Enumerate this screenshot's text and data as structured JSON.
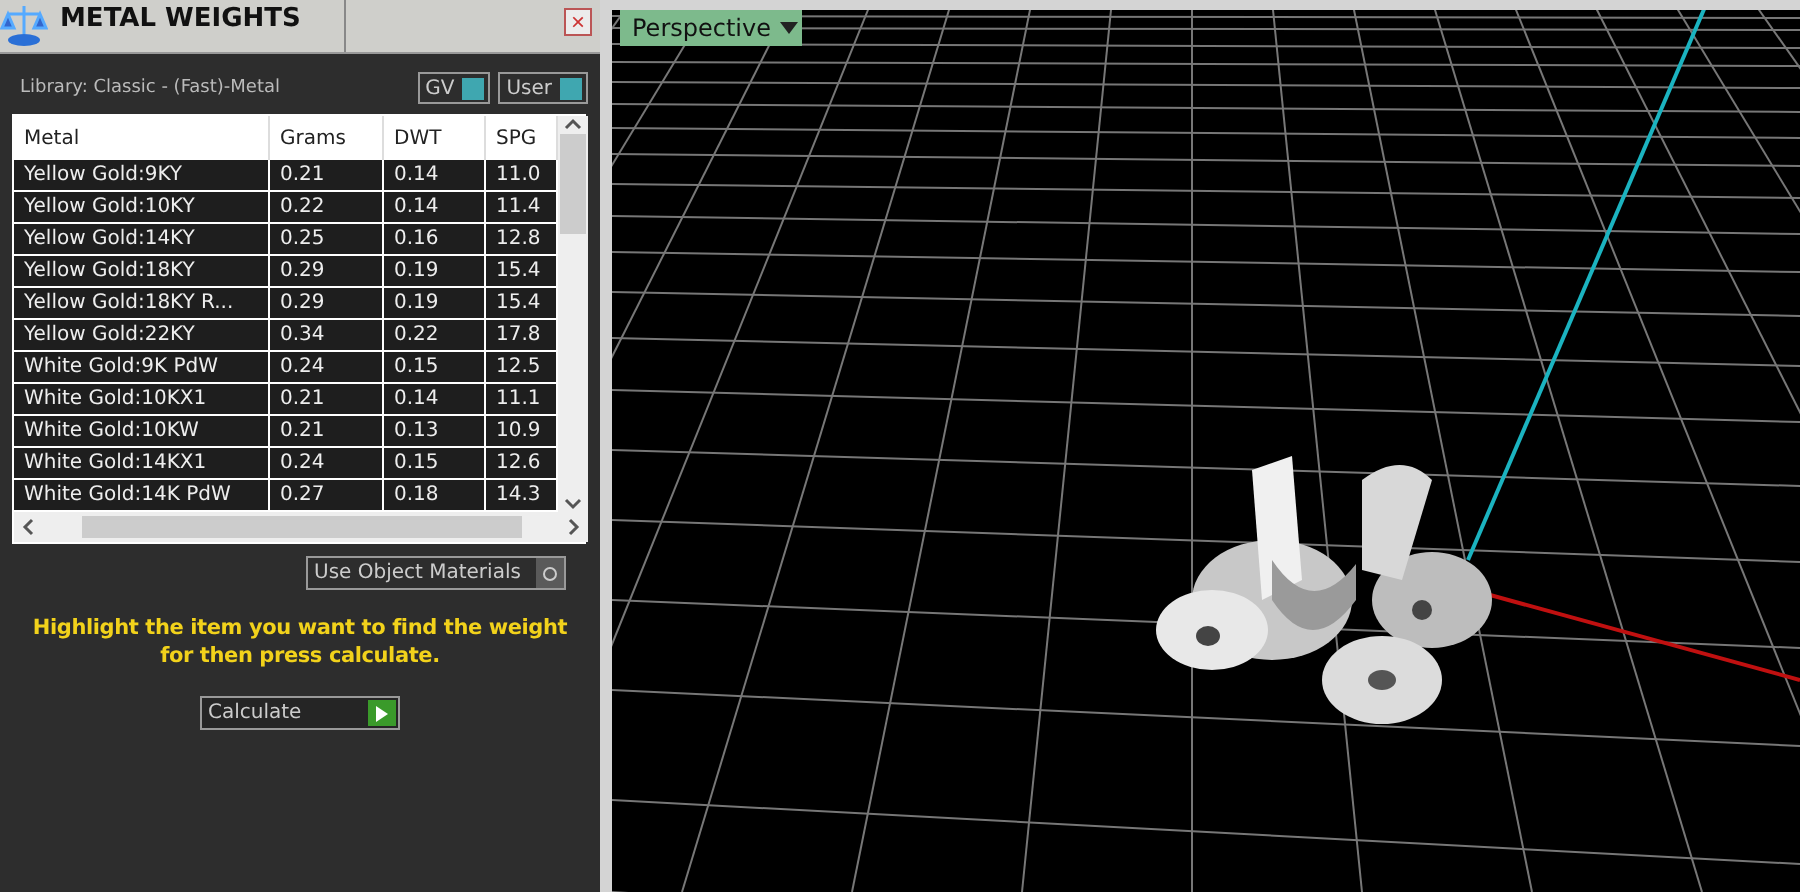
{
  "panel": {
    "title": "METAL WEIGHTS",
    "close": "×",
    "library": "Library: Classic - (Fast)-Metal",
    "toggles": [
      {
        "label": "GV",
        "on": true
      },
      {
        "label": "User",
        "on": true
      }
    ],
    "table": {
      "columns": [
        "Metal",
        "Grams",
        "DWT",
        "SPG"
      ],
      "rows": [
        [
          "Yellow Gold:9KY",
          "0.21",
          "0.14",
          "11.0"
        ],
        [
          "Yellow Gold:10KY",
          "0.22",
          "0.14",
          "11.4"
        ],
        [
          "Yellow Gold:14KY",
          "0.25",
          "0.16",
          "12.8"
        ],
        [
          "Yellow Gold:18KY",
          "0.29",
          "0.19",
          "15.4"
        ],
        [
          "Yellow Gold:18KY R...",
          "0.29",
          "0.19",
          "15.4"
        ],
        [
          "Yellow Gold:22KY",
          "0.34",
          "0.22",
          "17.8"
        ],
        [
          "White Gold:9K PdW",
          "0.24",
          "0.15",
          "12.5"
        ],
        [
          "White Gold:10KX1",
          "0.21",
          "0.14",
          "11.1"
        ],
        [
          "White Gold:10KW",
          "0.21",
          "0.13",
          "10.9"
        ],
        [
          "White Gold:14KX1",
          "0.24",
          "0.15",
          "12.6"
        ],
        [
          "White Gold:14K PdW",
          "0.27",
          "0.18",
          "14.3"
        ]
      ]
    },
    "use_object_materials": {
      "label": "Use Object Materials",
      "on": false
    },
    "hint": "Highlight the item you want to find the weight for then press calculate.",
    "calculate": "Calculate"
  },
  "viewport": {
    "view": "Perspective"
  }
}
